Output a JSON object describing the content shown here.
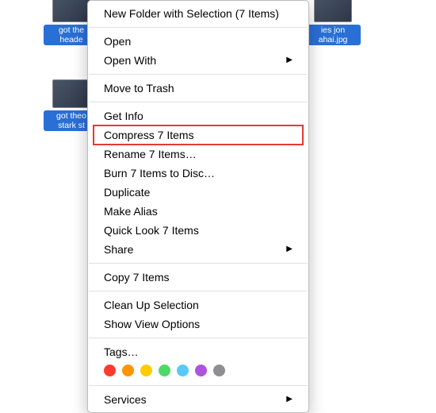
{
  "files": [
    {
      "label": "got the\nheade"
    },
    {
      "label": "ies jon\nahai.jpg"
    },
    {
      "label": "got theo\nstark st"
    }
  ],
  "menu": {
    "new_folder": "New Folder with Selection (7 Items)",
    "open": "Open",
    "open_with": "Open With",
    "move_to_trash": "Move to Trash",
    "get_info": "Get Info",
    "compress": "Compress 7 Items",
    "rename": "Rename 7 Items…",
    "burn": "Burn 7 Items to Disc…",
    "duplicate": "Duplicate",
    "make_alias": "Make Alias",
    "quick_look": "Quick Look 7 Items",
    "share": "Share",
    "copy": "Copy 7 Items",
    "clean_up": "Clean Up Selection",
    "show_view_options": "Show View Options",
    "tags_label": "Tags…",
    "services": "Services"
  },
  "tag_colors": [
    "#ff3b30",
    "#ff9500",
    "#ffcc00",
    "#4cd964",
    "#5ac8fa",
    "#af52de",
    "#8e8e93"
  ]
}
